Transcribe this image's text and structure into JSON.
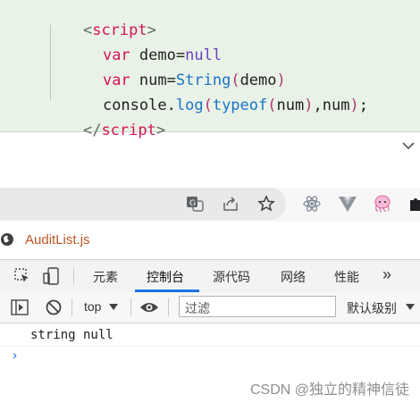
{
  "editor": {
    "lines": {
      "l1": {
        "open": "<",
        "tag": "script",
        "close": ">"
      },
      "l2": {
        "kw": "var",
        "ident": "demo",
        "eq": "=",
        "value": "null"
      },
      "l3": {
        "kw": "var",
        "ident": "num",
        "eq": "=",
        "cls": "String",
        "lp": "(",
        "arg": "demo",
        "rp": ")"
      },
      "l4": {
        "obj": "console",
        "dot": ".",
        "method": "log",
        "lp": "(",
        "fn": "typeof",
        "lp2": "(",
        "arg": "num",
        "rp2": ")",
        "comma": ",",
        "arg2": "num",
        "rp": ")",
        "semi": ";"
      },
      "l5": {
        "open": "</",
        "tag": "script",
        "close": ">"
      }
    }
  },
  "file_tab": {
    "name": "AuditList.js"
  },
  "devtools": {
    "tabs": [
      "元素",
      "控制台",
      "源代码",
      "网络",
      "性能"
    ],
    "active_tab": "控制台",
    "more": "»",
    "context": "top",
    "filter_placeholder": "过滤",
    "levels": "默认级别",
    "output": "string null",
    "prompt": "›"
  },
  "watermark": "CSDN @独立的精神信徒",
  "colors": {
    "accent": "#1a73e8",
    "file_name": "#c0551f",
    "editor_bg": "#e8f2e6"
  }
}
